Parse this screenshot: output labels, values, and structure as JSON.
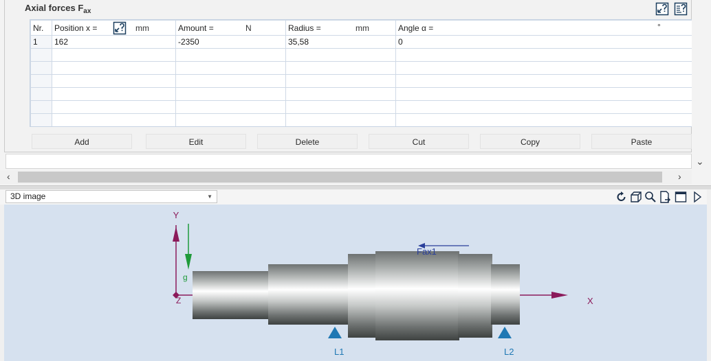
{
  "section": {
    "title": "Axial forces F",
    "title_sub": "ax"
  },
  "grid": {
    "headers": {
      "nr": "Nr.",
      "position": "Position x =",
      "position_unit": "mm",
      "amount": "Amount =",
      "amount_unit": "N",
      "radius": "Radius =",
      "radius_unit": "mm",
      "angle": "Angle α =",
      "angle_unit": "°"
    },
    "rows": [
      {
        "nr": "1",
        "position": "162",
        "amount": "-2350",
        "radius": "35,58",
        "angle": "0"
      }
    ]
  },
  "buttons": {
    "add": "Add",
    "edit": "Edit",
    "delete": "Delete",
    "cut": "Cut",
    "copy": "Copy",
    "paste": "Paste"
  },
  "view": {
    "selected": "3D image"
  },
  "scene": {
    "axis_y": "Y",
    "axis_x": "X",
    "axis_z": "Z",
    "gravity": "g",
    "force": "Fax1",
    "bearing1": "L1",
    "bearing2": "L2",
    "colors": {
      "axis": "#8b1a5a",
      "gravity": "#1f9a3a",
      "force": "#2a3f9a",
      "bearing": "#1f78b4",
      "background": "#d6e1ef"
    }
  },
  "icons": {
    "help_context": "help-context-icon",
    "help_info": "help-info-icon",
    "rotate": "rotate-icon",
    "box_view": "box-view-icon",
    "zoom": "zoom-icon",
    "export": "export-icon",
    "window": "window-icon",
    "play": "play-icon"
  }
}
